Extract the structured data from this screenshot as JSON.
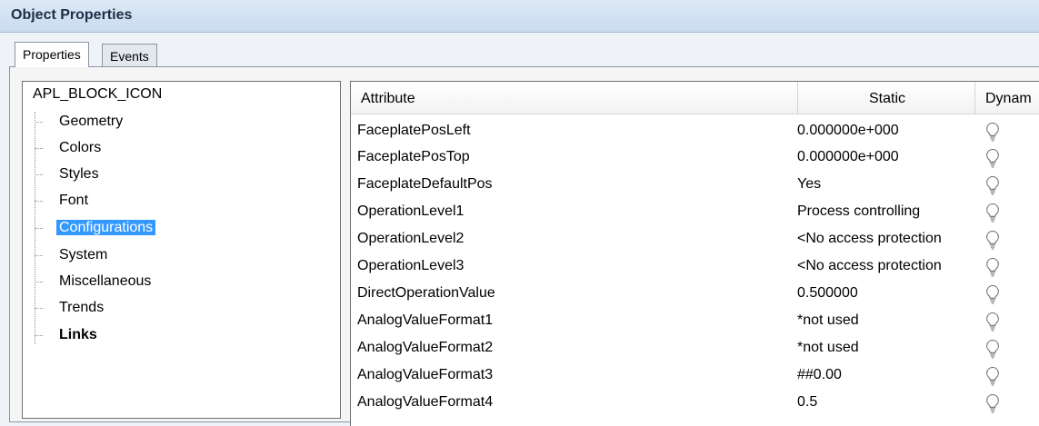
{
  "window": {
    "title": "Object Properties"
  },
  "tabs": [
    {
      "label": "Properties",
      "active": true
    },
    {
      "label": "Events",
      "active": false
    }
  ],
  "tree": {
    "root": "APL_BLOCK_ICON",
    "items": [
      {
        "label": "Geometry"
      },
      {
        "label": "Colors"
      },
      {
        "label": "Styles"
      },
      {
        "label": "Font"
      },
      {
        "label": "Configurations",
        "selected": true
      },
      {
        "label": "System"
      },
      {
        "label": "Miscellaneous"
      },
      {
        "label": "Trends"
      },
      {
        "label": "Links",
        "bold": true
      }
    ]
  },
  "table": {
    "columns": [
      "Attribute",
      "Static",
      "Dynam"
    ],
    "rows": [
      {
        "attribute": "FaceplatePosLeft",
        "static": "0.000000e+000",
        "dynamic_icon": "lightbulb-icon"
      },
      {
        "attribute": "FaceplatePosTop",
        "static": "0.000000e+000",
        "dynamic_icon": "lightbulb-icon"
      },
      {
        "attribute": "FaceplateDefaultPos",
        "static": "Yes",
        "dynamic_icon": "lightbulb-icon"
      },
      {
        "attribute": "OperationLevel1",
        "static": "Process controlling",
        "dynamic_icon": "lightbulb-icon"
      },
      {
        "attribute": "OperationLevel2",
        "static": "<No access protection",
        "dynamic_icon": "lightbulb-icon"
      },
      {
        "attribute": "OperationLevel3",
        "static": "<No access protection",
        "dynamic_icon": "lightbulb-icon"
      },
      {
        "attribute": "DirectOperationValue",
        "static": "0.500000",
        "dynamic_icon": "lightbulb-icon"
      },
      {
        "attribute": "AnalogValueFormat1",
        "static": "*not used",
        "dynamic_icon": "lightbulb-icon"
      },
      {
        "attribute": "AnalogValueFormat2",
        "static": "*not used",
        "dynamic_icon": "lightbulb-icon"
      },
      {
        "attribute": "AnalogValueFormat3",
        "static": "##0.00",
        "dynamic_icon": "lightbulb-icon"
      },
      {
        "attribute": "AnalogValueFormat4",
        "static": "0.5",
        "dynamic_icon": "lightbulb-icon"
      }
    ]
  },
  "colors": {
    "selection": "#3399ff",
    "titlebar": "#c8dbef"
  }
}
